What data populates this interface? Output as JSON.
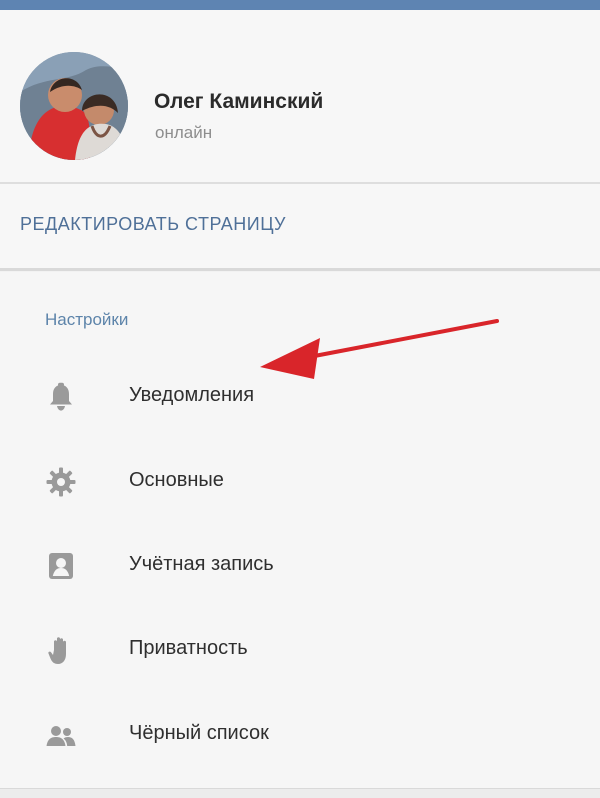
{
  "profile": {
    "name": "Олег Каминский",
    "status": "онлайн"
  },
  "actions": {
    "edit_page": "РЕДАКТИРОВАТЬ СТРАНИЦУ"
  },
  "settings": {
    "header": "Настройки",
    "items": [
      {
        "label": "Уведомления",
        "icon": "bell-icon"
      },
      {
        "label": "Основные",
        "icon": "gear-icon"
      },
      {
        "label": "Учётная запись",
        "icon": "account-icon"
      },
      {
        "label": "Приватность",
        "icon": "hand-icon"
      },
      {
        "label": "Чёрный список",
        "icon": "people-icon"
      }
    ]
  },
  "colors": {
    "accent": "#5d84aa",
    "link": "#4f7098",
    "annotation_arrow": "#d9252a",
    "icon": "#9a9a9a"
  }
}
